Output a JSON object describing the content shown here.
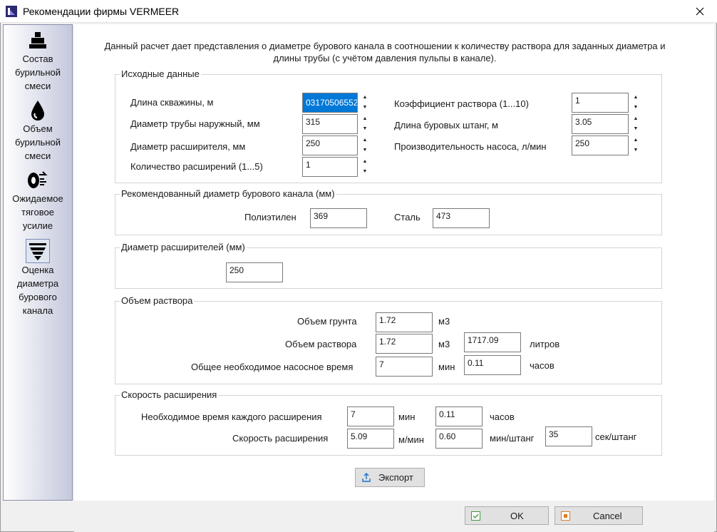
{
  "window": {
    "title": "Рекомендации фирмы VERMEER"
  },
  "sidebar": {
    "items": [
      {
        "label": "Состав\nбурильной\nсмеси",
        "icon": "mixer-icon"
      },
      {
        "label": "Объем\nбурильной\nсмеси",
        "icon": "drop-icon"
      },
      {
        "label": "Ожидаемое\nтяговое\nусилие",
        "icon": "pull-force-icon"
      },
      {
        "label": "Оценка\nдиаметра\nбурового\nканала",
        "icon": "funnel-icon"
      }
    ]
  },
  "intro": "Данный расчет дает представления о диаметре бурового канала в соотношении к количеству раствора для заданных диаметра и длины трубы (с учётом давления пульпы в канале).",
  "input_group": {
    "title": "Исходные данные",
    "length_label": "Длина скважины, м",
    "length_value": "03170506552",
    "pipe_diam_label": "Диаметр трубы наружный, мм",
    "pipe_diam_value": "315",
    "reamer_diam_label": "Диаметр расширителя, мм",
    "reamer_diam_value": "250",
    "passes_label": "Количество расширений (1...5)",
    "passes_value": "1",
    "ratio_label": "Коэффициент раствора (1...10)",
    "ratio_value": "1",
    "rod_len_label": "Длина буровых штанг, м",
    "rod_len_value": "3.05",
    "pump_label": "Производительность насоса, л/мин",
    "pump_value": "250"
  },
  "recommended_group": {
    "title": "Рекомендованный диаметр бурового канала (мм)",
    "pe_label": "Полиэтилен",
    "pe_value": "369",
    "steel_label": "Сталь",
    "steel_value": "473"
  },
  "reamers_group": {
    "title": "Диаметр расширителей (мм)",
    "value": "250"
  },
  "volume_group": {
    "title": "Объем раствора",
    "soil_label": "Объем грунта",
    "soil_value": "1.72",
    "soil_unit": "м3",
    "fluid_label": "Объем раствора",
    "fluid_value": "1.72",
    "fluid_unit": "м3",
    "fluid_liters": "1717.09",
    "liters_unit": "литров",
    "pump_time_label": "Общее необходимое насосное время",
    "pump_time_min": "7",
    "min_unit": "мин",
    "pump_time_hours": "0.11",
    "hours_unit": "часов"
  },
  "speed_group": {
    "title": "Скорость расширения",
    "time_label": "Необходимое время каждого расширения",
    "time_min": "7",
    "time_min_unit": "мин",
    "time_hours": "0.11",
    "time_hours_unit": "часов",
    "speed_label": "Скорость расширения",
    "speed_value": "5.09",
    "speed_unit": "м/мин",
    "speed_min_rod": "0.60",
    "min_rod_unit": "мин/штанг",
    "speed_sec_rod": "35",
    "sec_rod_unit": "сек/штанг"
  },
  "buttons": {
    "export": "Экспорт",
    "ok": "OK",
    "cancel": "Cancel"
  }
}
